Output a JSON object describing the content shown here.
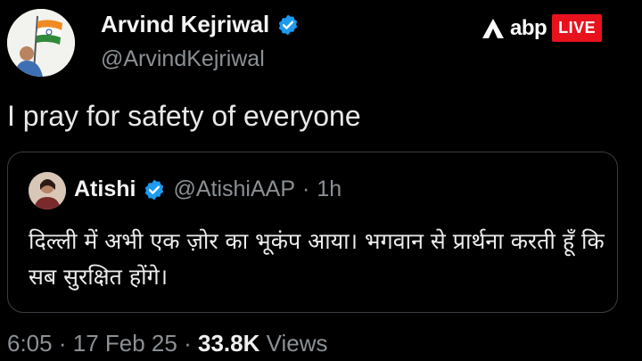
{
  "author": {
    "name": "Arvind Kejriwal",
    "handle": "@ArvindKejriwal"
  },
  "brand": {
    "logo_text": "abp",
    "live_label": "LIVE",
    "live_color": "#e8121d"
  },
  "tweet": {
    "text": "I pray for safety of everyone"
  },
  "quoted_tweet": {
    "name": "Atishi",
    "handle": "@AtishiAAP",
    "separator": "·",
    "time_ago": "1h",
    "text": "दिल्ली में अभी एक ज़ोर का भूकंप आया। भगवान से प्रार्थना करती हूँ कि सब सुरक्षित होंगे।"
  },
  "meta": {
    "time": "6:05",
    "date": "17 Feb 25",
    "separator": "·",
    "views_count": "33.8K",
    "views_label": "Views"
  },
  "colors": {
    "background": "#000000",
    "verified_blue": "#1d9bf0",
    "muted_text": "#8b9095"
  }
}
